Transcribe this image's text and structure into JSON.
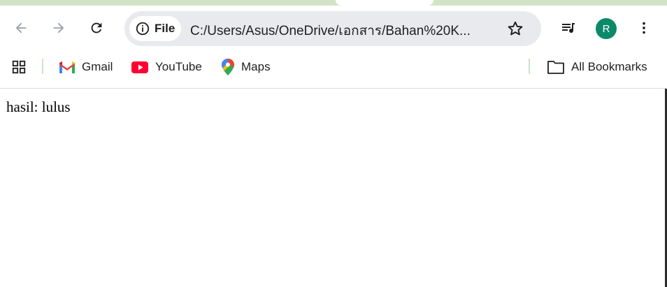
{
  "browser": {
    "address_bar": {
      "security_chip_label": "File",
      "url": "C:/Users/Asus/OneDrive/เอกสาร/Bahan%20K..."
    },
    "icons": {
      "back": "back-arrow-icon",
      "forward": "forward-arrow-icon",
      "reload": "reload-icon",
      "info": "info-icon",
      "bookmark_star": "star-icon",
      "media": "media-queue-icon",
      "menu": "kebab-menu-icon"
    },
    "profile": {
      "initial": "R",
      "color": "#0b8a6a"
    }
  },
  "bookmarks_bar": {
    "items": [
      {
        "label": "Gmail",
        "icon": "gmail-icon"
      },
      {
        "label": "YouTube",
        "icon": "youtube-icon"
      },
      {
        "label": "Maps",
        "icon": "maps-icon"
      }
    ],
    "all_bookmarks_label": "All Bookmarks"
  },
  "page": {
    "text": "hasil: lulus"
  }
}
